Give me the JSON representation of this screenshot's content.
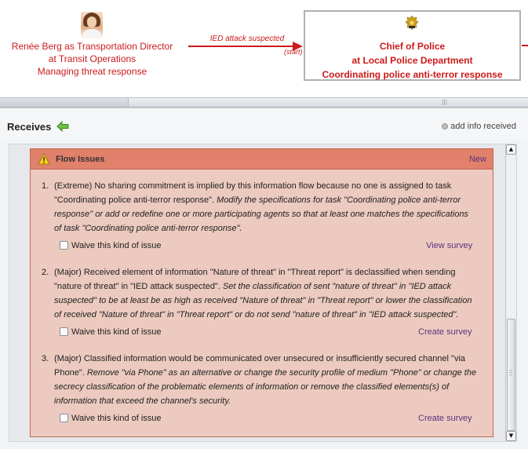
{
  "flow": {
    "source_line1": "Renée Berg as Transportation Director",
    "source_line2": "at Transit Operations",
    "source_line3": "Managing threat response",
    "edge_label": "IED attack suspected",
    "edge_start": "(start)",
    "target_line1": "Chief of Police",
    "target_line2": "at Local Police Department",
    "target_line3": "Coordinating police anti-terror response",
    "source_icon": "person-photo-icon",
    "target_icon": "police-badge-icon",
    "accent_color": "#cc1a1a"
  },
  "panel": {
    "title": "Receives",
    "back_icon": "green-back-arrow-icon",
    "add_info_label": "add info received"
  },
  "issues": {
    "title": "Flow Issues",
    "new_label": "New",
    "header_color": "#e1806b",
    "body_color": "#eccabf",
    "items": [
      {
        "num": "1.",
        "text": "(Extreme) No sharing commitment is implied by this information flow because no one is assigned to task \"Coordinating police anti-terror response\".",
        "remedy": "Modify the specifications for task \"Coordinating police anti-terror response\" or add or redefine one or more participating agents so that at least one matches the specifications of task \"Coordinating police anti-terror response\".",
        "waive_label": "Waive this kind of issue",
        "survey_label": "View survey"
      },
      {
        "num": "2.",
        "text": "(Major) Received element of information \"Nature of threat\" in \"Threat report\" is declassified when sending \"nature of threat\" in \"IED attack suspected\".",
        "remedy": "Set the classification of sent \"nature of threat\" in \"IED attack suspected\" to be at least be as high as received \"Nature of threat\" in \"Threat report\" or lower the classification of received \"Nature of threat\" in \"Threat report\" or do not send \"nature of threat\" in \"IED attack suspected\".",
        "waive_label": "Waive this kind of issue",
        "survey_label": "Create survey"
      },
      {
        "num": "3.",
        "text": "(Major) Classified information would be communicated over unsecured or insufficiently secured channel \"via Phone\".",
        "remedy": "Remove \"via Phone\" as an alternative or change the security profile of medium \"Phone\" or change the secrecy classification of the problematic elements of information or remove the classified elements(s) of information that exceed the channel's security.",
        "waive_label": "Waive this kind of issue",
        "survey_label": "Create survey"
      }
    ]
  }
}
